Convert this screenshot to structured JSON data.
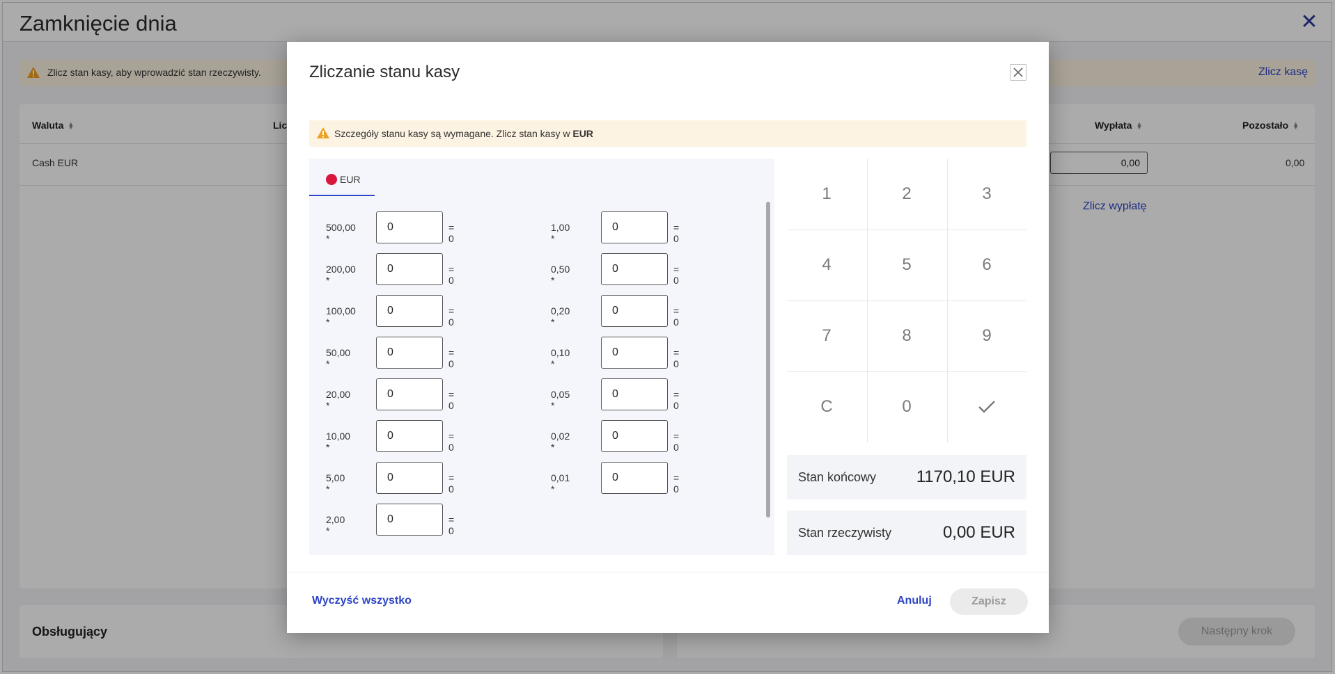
{
  "page": {
    "title": "Zamknięcie dnia",
    "warning_text": "Zlicz stan kasy, aby wprowadzić stan rzeczywisty.",
    "count_cash_link": "Zlicz kasę",
    "table": {
      "headers": {
        "currency": "Waluta",
        "count": "Licz",
        "payout": "Wypłata",
        "remaining": "Pozostało"
      },
      "row": {
        "currency": "Cash EUR",
        "payout_value": "0,00",
        "remaining": "0,00"
      },
      "count_payout_link": "Zlicz wypłatę"
    },
    "operator_label": "Obsługujący",
    "next_step_label": "Następny krok"
  },
  "modal": {
    "title": "Zliczanie stanu kasy",
    "warning_prefix": "Szczegóły stanu kasy są wymagane. Zlicz stan kasy w ",
    "warning_currency": "EUR",
    "currency_tab": "EUR",
    "currency_color": "#d8173c",
    "denominations_left": [
      {
        "label": "500,00 *",
        "value": "0",
        "result": "= 0"
      },
      {
        "label": "200,00 *",
        "value": "0",
        "result": "= 0"
      },
      {
        "label": "100,00 *",
        "value": "0",
        "result": "= 0"
      },
      {
        "label": "50,00 *",
        "value": "0",
        "result": "= 0"
      },
      {
        "label": "20,00 *",
        "value": "0",
        "result": "= 0"
      },
      {
        "label": "10,00 *",
        "value": "0",
        "result": "= 0"
      },
      {
        "label": "5,00 *",
        "value": "0",
        "result": "= 0"
      },
      {
        "label": "2,00 *",
        "value": "0",
        "result": "= 0"
      }
    ],
    "denominations_right": [
      {
        "label": "1,00 *",
        "value": "0",
        "result": "= 0"
      },
      {
        "label": "0,50 *",
        "value": "0",
        "result": "= 0"
      },
      {
        "label": "0,20 *",
        "value": "0",
        "result": "= 0"
      },
      {
        "label": "0,10 *",
        "value": "0",
        "result": "= 0"
      },
      {
        "label": "0,05 *",
        "value": "0",
        "result": "= 0"
      },
      {
        "label": "0,02 *",
        "value": "0",
        "result": "= 0"
      },
      {
        "label": "0,01 *",
        "value": "0",
        "result": "= 0"
      }
    ],
    "numpad": [
      "1",
      "2",
      "3",
      "4",
      "5",
      "6",
      "7",
      "8",
      "9",
      "C",
      "0",
      "✓"
    ],
    "final_balance": {
      "label": "Stan końcowy",
      "value": "1170,10 EUR"
    },
    "actual_balance": {
      "label": "Stan rzeczywisty",
      "value": "0,00 EUR"
    },
    "clear_all_label": "Wyczyść wszystko",
    "cancel_label": "Anuluj",
    "save_label": "Zapisz"
  },
  "icons": {
    "warning": "warning-triangle-icon",
    "close": "close-icon"
  },
  "colors": {
    "accent": "#2d44c4",
    "warning": "#f0a020",
    "warning_bg": "#fdf3e2"
  }
}
